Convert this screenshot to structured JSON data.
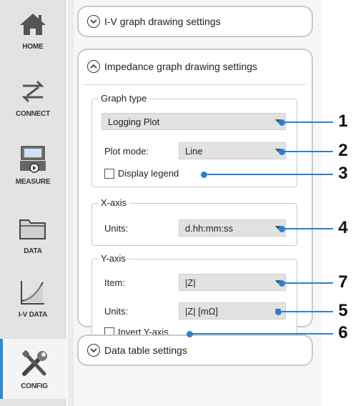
{
  "sidebar": {
    "items": [
      {
        "label": "HOME",
        "icon": "home-icon"
      },
      {
        "label": "CONNECT",
        "icon": "connect-icon"
      },
      {
        "label": "MEASURE",
        "icon": "measure-icon"
      },
      {
        "label": "DATA",
        "icon": "folder-icon"
      },
      {
        "label": "I-V DATA",
        "icon": "iv-curve-icon"
      },
      {
        "label": "CONFIG",
        "icon": "tools-icon",
        "active": true
      }
    ]
  },
  "sections": {
    "iv": {
      "label": "I-V graph drawing settings",
      "expanded": false
    },
    "impedance": {
      "label": "Impedance graph drawing settings",
      "expanded": true
    },
    "table": {
      "label": "Data table settings",
      "expanded": false
    }
  },
  "graph_type": {
    "title": "Graph type",
    "type_value": "Logging Plot",
    "plot_mode_label": "Plot mode:",
    "plot_mode_value": "Line",
    "display_legend_label": "Display legend",
    "display_legend_checked": false
  },
  "x_axis": {
    "title": "X-axis",
    "units_label": "Units:",
    "units_value": "d.hh:mm:ss"
  },
  "y_axis": {
    "title": "Y-axis",
    "item_label": "Item:",
    "item_value": "|Z|",
    "units_label": "Units:",
    "units_value": "|Z| [mΩ]",
    "invert_label": "Invert Y-axis",
    "invert_checked": false
  },
  "callouts": [
    "1",
    "2",
    "3",
    "4",
    "7",
    "5",
    "6"
  ],
  "colors": {
    "accent": "#2d7fd0",
    "active_nav_border": "#2f8ad8"
  }
}
